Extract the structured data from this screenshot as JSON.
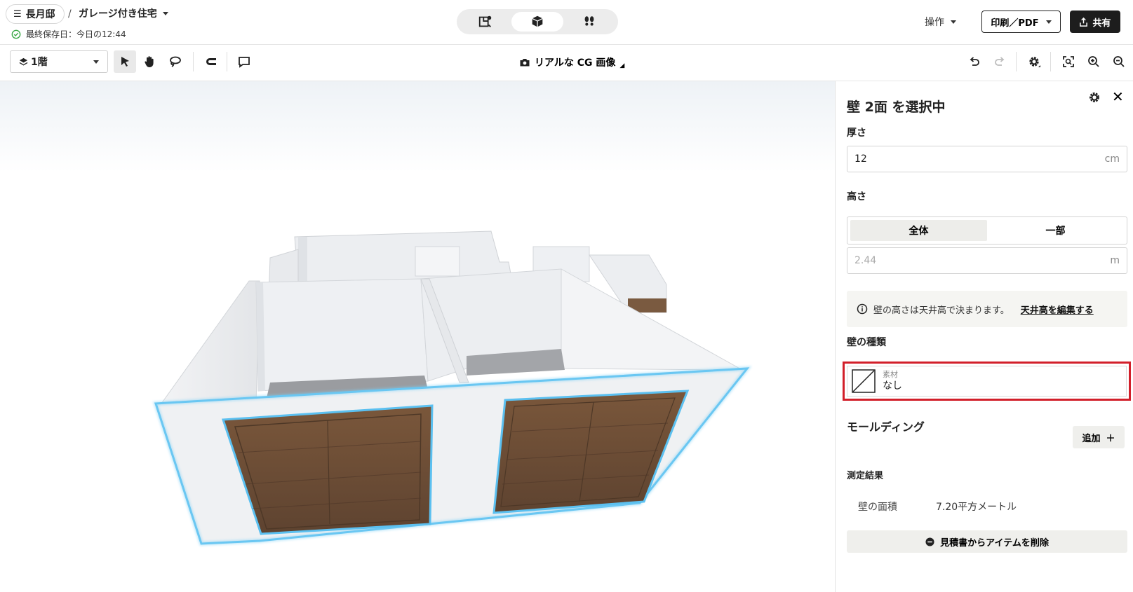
{
  "header": {
    "project_owner": "長月邸",
    "breadcrumb_sep": "/",
    "project_title": "ガレージ付き住宅",
    "save_status": "最終保存日：今日の12:44",
    "ops_label": "操作",
    "print_label": "印刷／PDF",
    "share_label": "共有",
    "view_modes": [
      "floorplan-2d",
      "view-3d",
      "walkthrough"
    ],
    "active_view": "view-3d"
  },
  "toolbar": {
    "floor_label": "1階",
    "cg_label": "リアルな CG 画像",
    "tools": [
      "select-arrow",
      "pan-hand",
      "lasso",
      "magnet",
      "comment"
    ]
  },
  "panel": {
    "title": "壁 2面 を選択中",
    "thickness_label": "厚さ",
    "thickness_value": "12",
    "thickness_unit": "cm",
    "height_label": "高さ",
    "height_options": [
      "全体",
      "一部"
    ],
    "height_selected": "全体",
    "height_value": "2.44",
    "height_unit": "m",
    "info_text": "壁の高さは天井高で決まります。",
    "info_link": "天井高を編集する",
    "wall_type_label": "壁の種類",
    "material_label": "素材",
    "material_value": "なし",
    "molding_label": "モールディング",
    "add_label": "追加",
    "measure_label": "測定結果",
    "area_label": "壁の面積",
    "area_value": "7.20平方メートル",
    "remove_label": "見積書からアイテムを削除"
  },
  "colors": {
    "highlight": "#d21f2a",
    "selection_glow": "#5bc0f0",
    "door_wood": "#6f4f36",
    "wall": "#eef0f3"
  }
}
